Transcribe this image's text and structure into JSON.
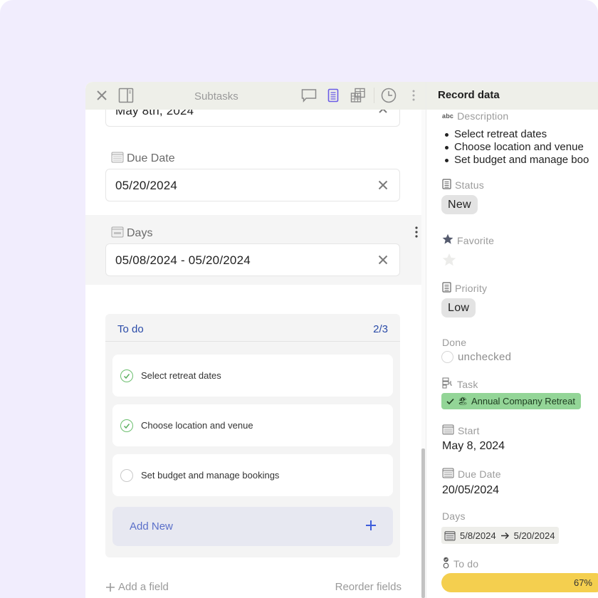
{
  "toolbar": {
    "title": "Subtasks",
    "icons": [
      "close-icon",
      "sidebar-toggle-icon",
      "comment-icon",
      "record-icon",
      "table-icon",
      "history-icon",
      "more-icon"
    ]
  },
  "left_panel": {
    "start_partial_value": "May 8th, 2024",
    "due_date": {
      "label": "Due Date",
      "value": "05/20/2024"
    },
    "days": {
      "label": "Days",
      "value": "05/08/2024 - 05/20/2024"
    },
    "todo": {
      "title": "To do",
      "count": "2/3",
      "items": [
        {
          "label": "Select retreat dates",
          "done": true
        },
        {
          "label": "Choose location and venue",
          "done": true
        },
        {
          "label": "Set budget and manage bookings",
          "done": false
        }
      ],
      "add_new_label": "Add New"
    },
    "add_field_label": "Add a field",
    "reorder_fields_label": "Reorder fields"
  },
  "right_panel": {
    "title": "Record data",
    "description": {
      "label": "Description",
      "type_badge": "abc",
      "items": [
        "Select retreat dates",
        "Choose location and venue",
        "Set budget and manage boo"
      ]
    },
    "status": {
      "label": "Status",
      "value": "New"
    },
    "favorite": {
      "label": "Favorite",
      "value": false
    },
    "priority": {
      "label": "Priority",
      "value": "Low"
    },
    "done": {
      "label": "Done",
      "value": "unchecked"
    },
    "task": {
      "label": "Task",
      "value": "Annual Company Retreat",
      "emoji": "🏖"
    },
    "start": {
      "label": "Start",
      "value": "May 8, 2024"
    },
    "due_date": {
      "label": "Due Date",
      "value": "20/05/2024"
    },
    "days": {
      "label": "Days",
      "from": "5/8/2024",
      "to": "5/20/2024"
    },
    "todo": {
      "label": "To do",
      "progress_percent": 67,
      "progress_text": "67%"
    }
  },
  "colors": {
    "backdrop": "#f1edfd",
    "toolbar_bg": "#eeefe9",
    "accent_blue": "#2a4ba8",
    "active_icon": "#6b5ce7",
    "task_chip": "#93d597",
    "progress": "#f4cf4f",
    "check_green": "#6cbf6f"
  }
}
